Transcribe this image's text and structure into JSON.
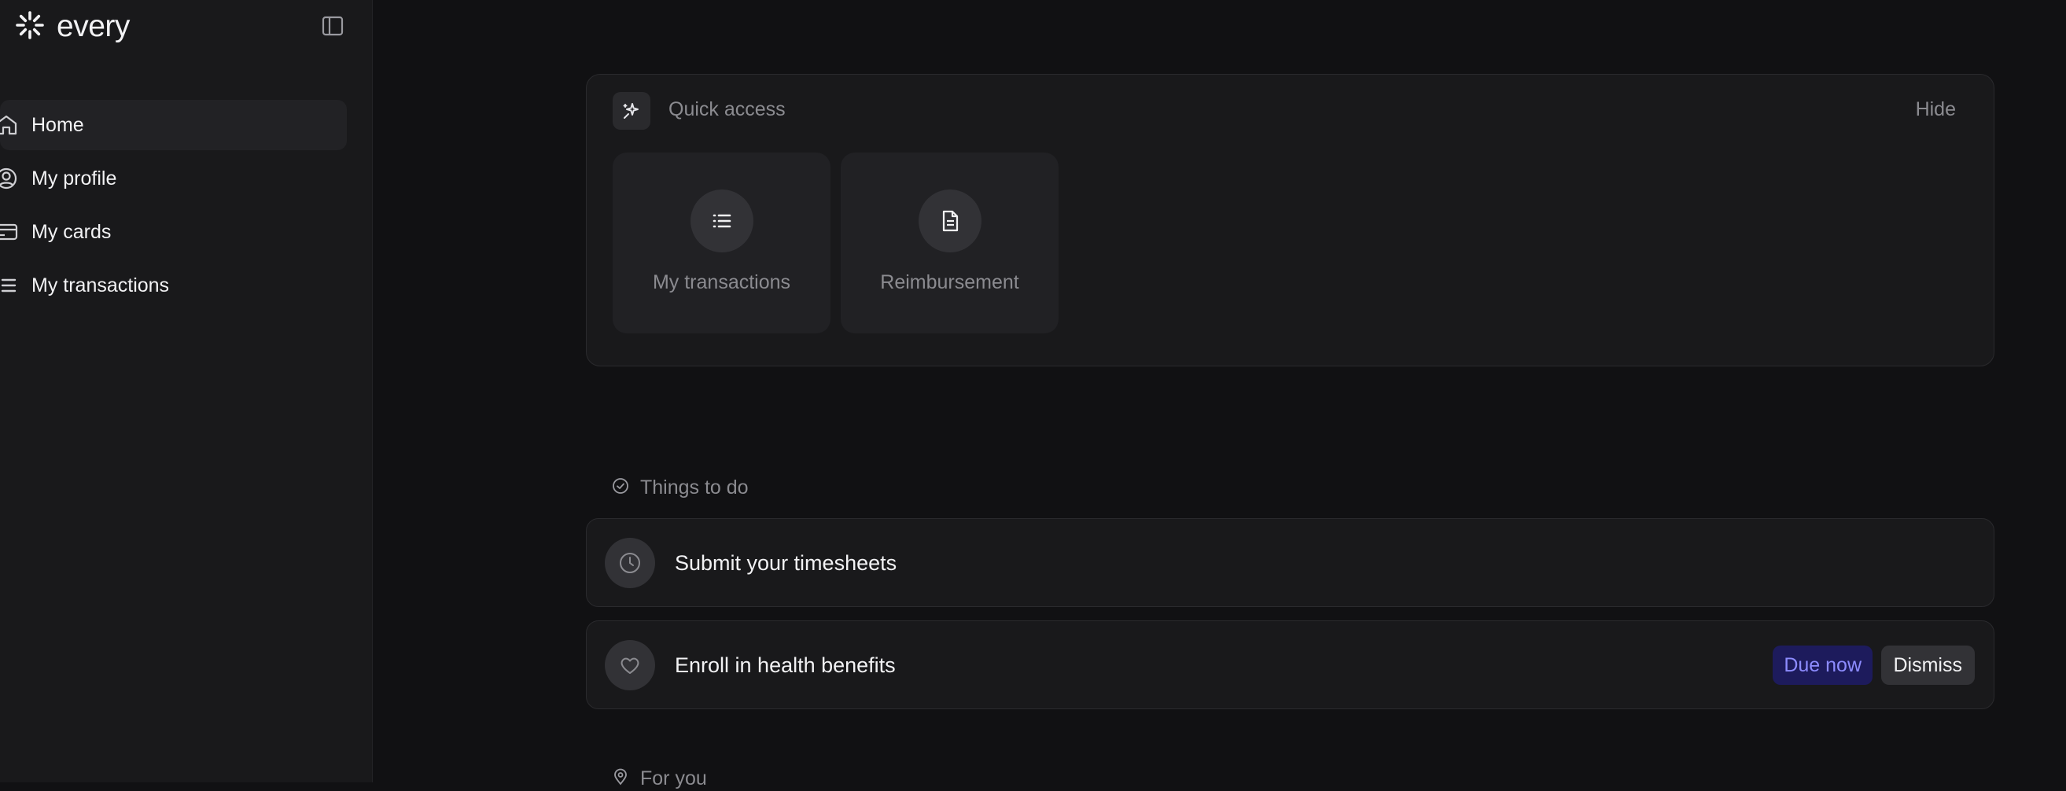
{
  "brand": {
    "name": "every",
    "logo_icon": "sunburst-logo"
  },
  "sidebar": {
    "collapse_icon": "sidebar-toggle-icon",
    "items": [
      {
        "label": "Home",
        "icon": "home-icon",
        "active": true
      },
      {
        "label": "My profile",
        "icon": "user-circle-icon",
        "active": false
      },
      {
        "label": "My cards",
        "icon": "credit-card-icon",
        "active": false
      },
      {
        "label": "My transactions",
        "icon": "list-icon",
        "active": false
      }
    ]
  },
  "quick_access": {
    "title": "Quick access",
    "hide_label": "Hide",
    "icon": "sparkle-icon",
    "tiles": [
      {
        "label": "My transactions",
        "icon": "list-icon"
      },
      {
        "label": "Reimbursement",
        "icon": "document-icon"
      }
    ]
  },
  "things_to_do": {
    "title": "Things to do",
    "icon": "check-circle-icon",
    "items": [
      {
        "label": "Submit your timesheets",
        "icon": "clock-icon"
      },
      {
        "label": "Enroll in health benefits",
        "icon": "heart-icon",
        "badge": "Due now",
        "action": "Dismiss"
      }
    ]
  },
  "for_you": {
    "title": "For you",
    "icon": "location-pin-icon"
  },
  "colors": {
    "background": "#111113",
    "sidebar": "#19191b",
    "accent_badge_bg": "#1d1b5c",
    "accent_badge_text": "#8d8cff"
  }
}
